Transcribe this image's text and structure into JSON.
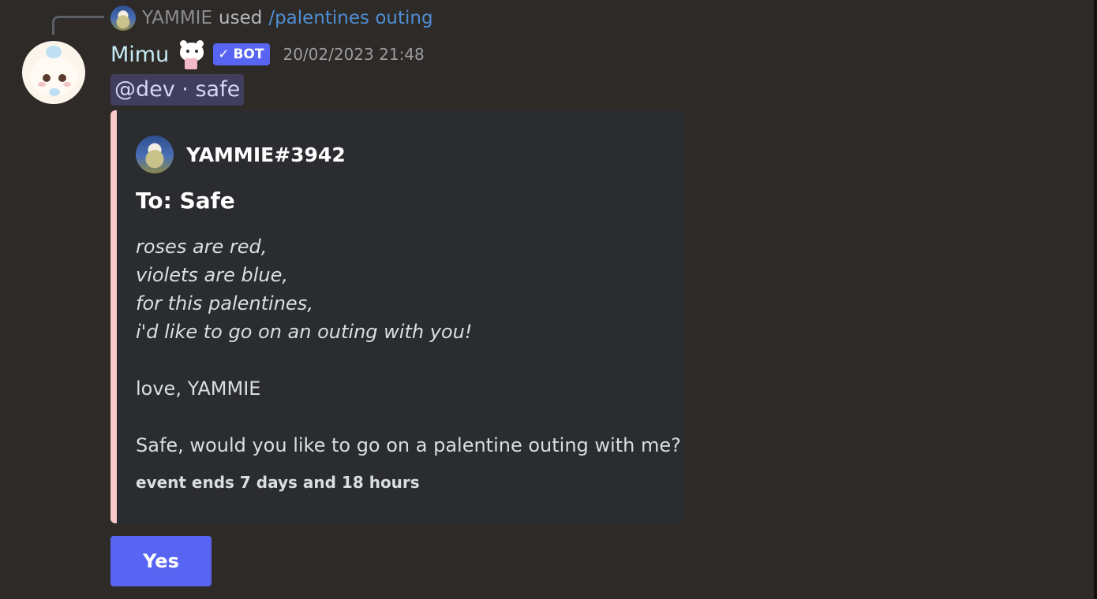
{
  "reply": {
    "user": "YAMMIE",
    "used": "used",
    "command": "/palentines outing"
  },
  "message": {
    "author": "Mimu",
    "bot_badge": "BOT",
    "timestamp": "20/02/2023 21:48",
    "mention": "@dev · safe"
  },
  "embed": {
    "author": "YAMMIE#3942",
    "title": "To: Safe",
    "poem": [
      "roses are red,",
      "violets are blue,",
      "for this palentines,",
      "i'd like to go on an outing with you!"
    ],
    "signoff": "love, YAMMIE",
    "question": "Safe, would you like to go on a palentine outing with me?",
    "footer": "event ends 7 days and 18 hours",
    "accent_color": "#f6c8c8"
  },
  "buttons": {
    "yes_label": "Yes"
  },
  "colors": {
    "background": "#2e2a27",
    "button": "#5865f2",
    "username": "#c7ecf8",
    "command_link": "#4f8fd6"
  }
}
